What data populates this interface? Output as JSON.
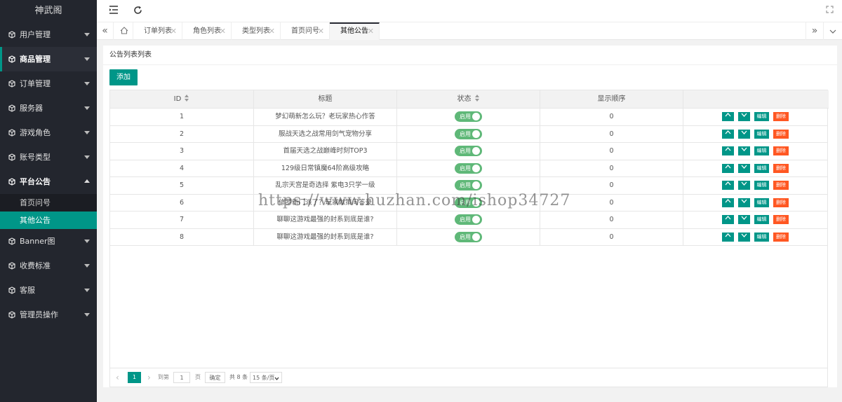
{
  "sidebar": {
    "brand": "神武阁",
    "items": [
      {
        "label": "用户管理"
      },
      {
        "label": "商品管理"
      },
      {
        "label": "订单管理"
      },
      {
        "label": "服务器"
      },
      {
        "label": "游戏角色"
      },
      {
        "label": "账号类型"
      },
      {
        "label": "平台公告"
      },
      {
        "label": "Banner图"
      },
      {
        "label": "收费标准"
      },
      {
        "label": "客服"
      },
      {
        "label": "管理员操作"
      }
    ],
    "sub_items": [
      {
        "label": "首页问号"
      },
      {
        "label": "其他公告"
      }
    ]
  },
  "tabs": [
    {
      "label": "订单列表"
    },
    {
      "label": "角色列表"
    },
    {
      "label": "类型列表"
    },
    {
      "label": "首页问号"
    },
    {
      "label": "其他公告"
    }
  ],
  "card": {
    "title": "公告列表列表",
    "add_label": "添加"
  },
  "table": {
    "headers": [
      "ID",
      "标题",
      "状态",
      "显示顺序",
      ""
    ],
    "switch_label": "启用",
    "actions": {
      "edit": "编辑",
      "delete": "删除"
    },
    "rows": [
      {
        "id": "1",
        "title": "梦幻萌新怎么玩？老玩家热心作答",
        "order": "0"
      },
      {
        "id": "2",
        "title": "服战天选之战常用剑气宠物分享",
        "order": "0"
      },
      {
        "id": "3",
        "title": "首届天选之战巅峰时刻TOP3",
        "order": "0"
      },
      {
        "id": "4",
        "title": "129级日常镇魔64阶高级攻略",
        "order": "0"
      },
      {
        "id": "5",
        "title": "乱宗天宫是奇选择 紫电3只学一级",
        "order": "0"
      },
      {
        "id": "6",
        "title": "修罗新门派了？玩家献策问答录",
        "order": "0"
      },
      {
        "id": "7",
        "title": "聊聊这游戏最强的封系到底是谁?",
        "order": "0"
      },
      {
        "id": "8",
        "title": "聊聊这游戏最强的封系到底是谁?",
        "order": "0"
      }
    ]
  },
  "pager": {
    "current": "1",
    "goto_label": "到第",
    "page_input": "1",
    "page_unit": "页",
    "confirm": "确定",
    "total": "共 8 条",
    "per_page": "15 条/页"
  },
  "watermark": "https://www.huzhan.com/ishop34727",
  "colors": {
    "accent": "#009688",
    "danger": "#ff5722",
    "switch": "#5fb878",
    "sidebar": "#23262e"
  }
}
